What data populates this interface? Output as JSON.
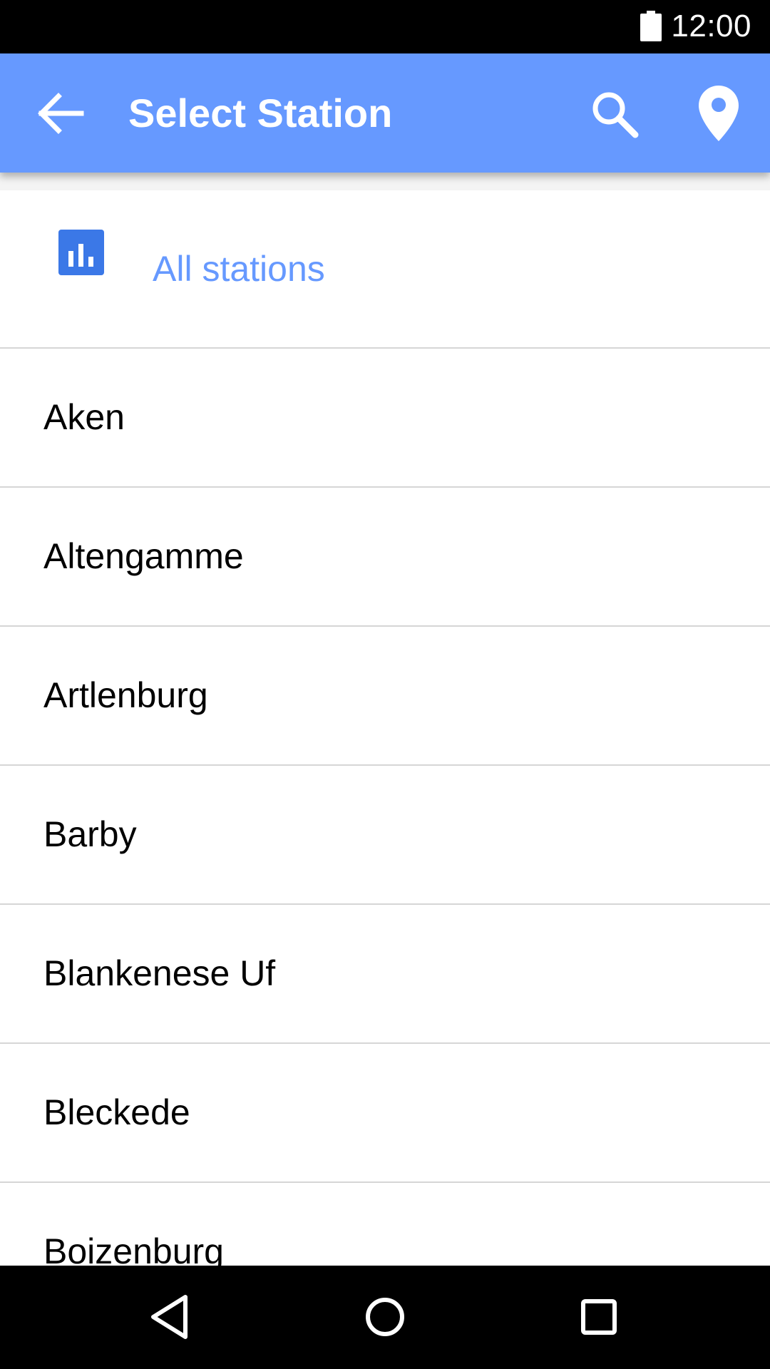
{
  "status_bar": {
    "time": "12:00",
    "battery_icon": "battery-full-icon"
  },
  "app_bar": {
    "title": "Select Station",
    "back_icon": "arrow-back-icon",
    "search_icon": "search-icon",
    "location_icon": "location-pin-icon",
    "color": "#6699ff"
  },
  "list": {
    "all_stations": {
      "label": "All stations",
      "icon": "bar-chart-icon",
      "color": "#6699ff"
    },
    "stations": [
      {
        "label": "Aken"
      },
      {
        "label": "Altengamme"
      },
      {
        "label": "Artlenburg"
      },
      {
        "label": "Barby"
      },
      {
        "label": "Blankenese Uf"
      },
      {
        "label": "Bleckede"
      },
      {
        "label": "Boizenburg"
      }
    ]
  },
  "nav_bar": {
    "back_icon": "nav-back-triangle-icon",
    "home_icon": "nav-home-circle-icon",
    "recents_icon": "nav-recents-square-icon"
  }
}
